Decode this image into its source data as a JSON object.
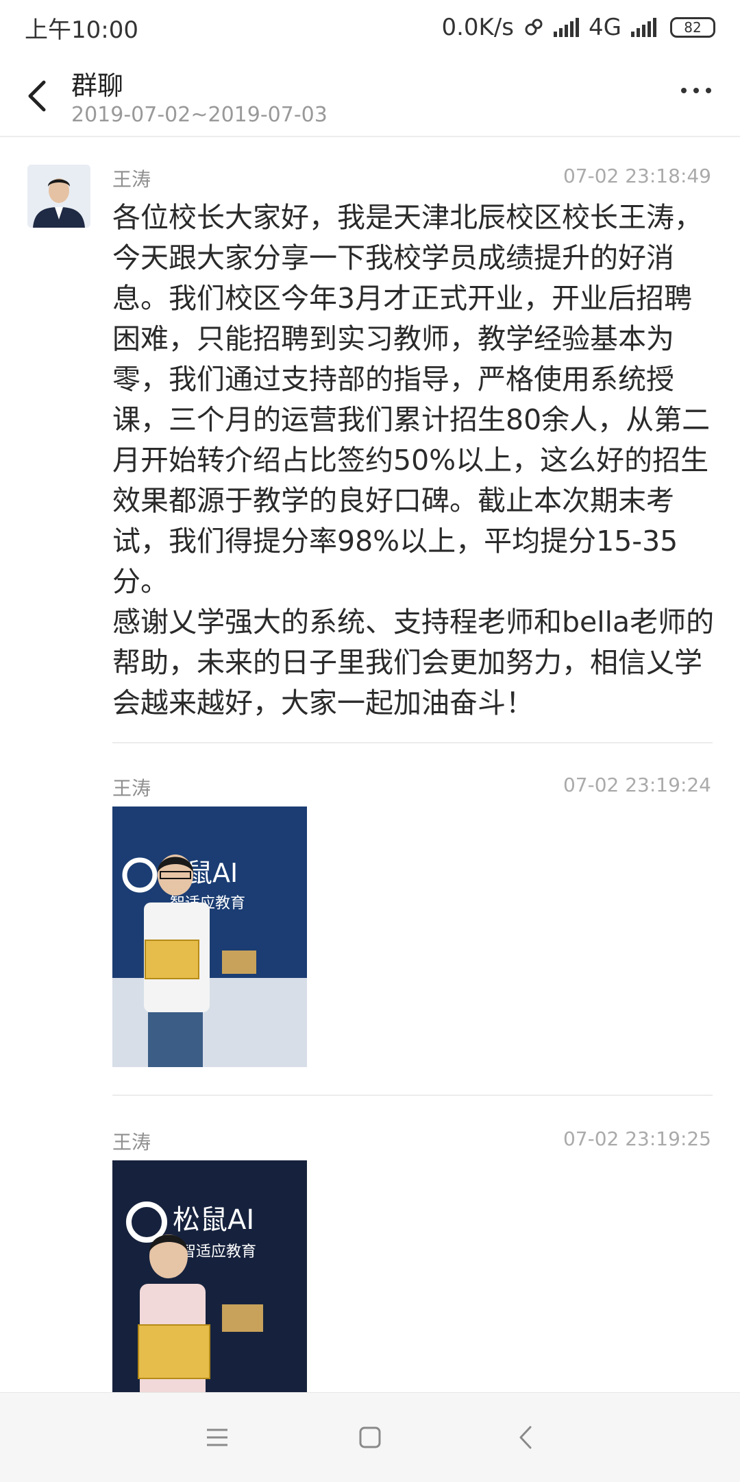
{
  "status_bar": {
    "time": "上午10:00",
    "speed": "0.0K/s",
    "network": "4G",
    "battery": "82"
  },
  "header": {
    "title": "群聊",
    "date_range": "2019-07-02~2019-07-03",
    "back_icon": "chevron-left-icon",
    "more_icon": "more-dots-icon"
  },
  "messages": [
    {
      "sender": "王涛",
      "time": "07-02 23:18:49",
      "text": "各位校长大家好，我是天津北辰校区校长王涛，今天跟大家分享一下我校学员成绩提升的好消息。我们校区今年3月才正式开业，开业后招聘困难，只能招聘到实习教师，教学经验基本为零，我们通过支持部的指导，严格使用系统授课，三个月的运营我们累计招生80余人，从第二月开始转介绍占比签约50%以上，这么好的招生效果都源于教学的良好口碑。截止本次期末考试，我们得提分率98%以上，平均提分15-35分。\n感谢乂学强大的系统、支持程老师和bella老师的帮助，未来的日子里我们会更加努力，相信乂学会越来越好，大家一起加油奋斗！"
    },
    {
      "sender": "王涛",
      "time": "07-02 23:19:24",
      "photo": {
        "brand": "松鼠AI",
        "tagline": "智适应教育"
      }
    },
    {
      "sender": "王涛",
      "time": "07-02 23:19:25",
      "photo": {
        "brand": "松鼠AI",
        "tagline": "智适应教育"
      }
    }
  ],
  "nav_bar": {
    "menu_icon": "menu-icon",
    "home_icon": "home-square-icon",
    "back_icon": "back-arrow-icon"
  }
}
